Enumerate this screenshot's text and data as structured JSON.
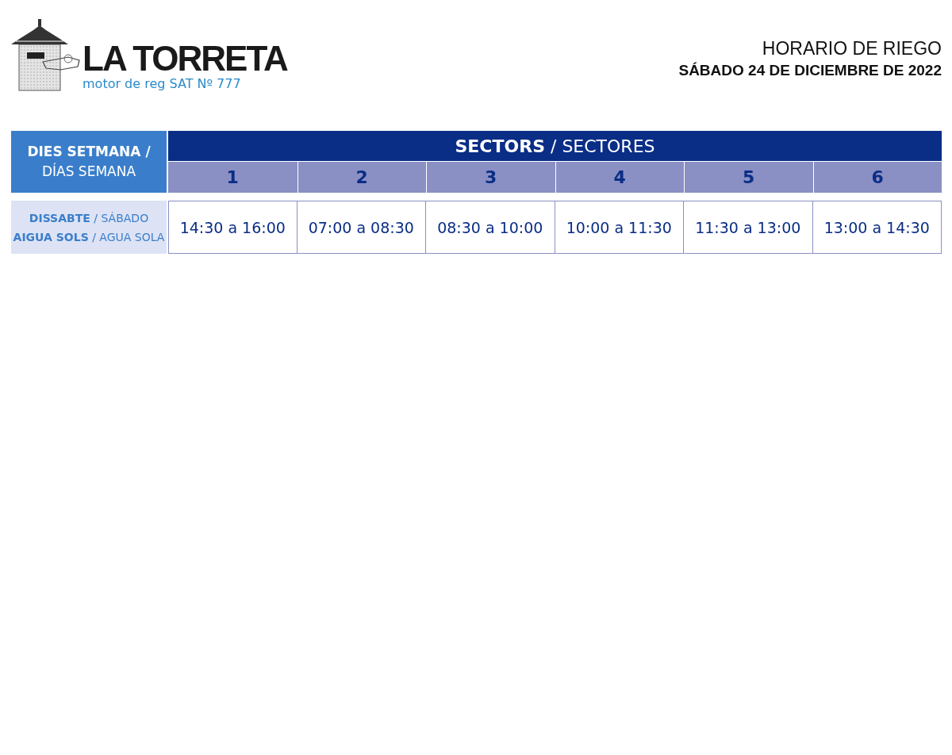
{
  "logo": {
    "name": "LA TORRETA",
    "tagline": "motor de reg SAT Nº 777"
  },
  "heading": {
    "title": "HORARIO DE RIEGO",
    "date": "SÁBADO 24 DE DICIEMBRE DE 2022"
  },
  "table": {
    "corner": {
      "line_1": "DIES SETMANA /",
      "line_2": "DÍAS SEMANA"
    },
    "group_header": "**SECTORS** / SECTORES",
    "columns": [
      "1",
      "2",
      "3",
      "4",
      "5",
      "6"
    ],
    "rows": [
      {
        "labels": [
          "**DISSABTE** / SÁBADO",
          "**AIGUA SOLS** / AGUA SOLA"
        ],
        "cells": [
          "14:30 a 16:00",
          "07:00 a 08:30",
          "08:30 a 10:00",
          "10:00 a 11:30",
          "11:30 a 13:00",
          "13:00 a 14:30"
        ]
      }
    ]
  }
}
